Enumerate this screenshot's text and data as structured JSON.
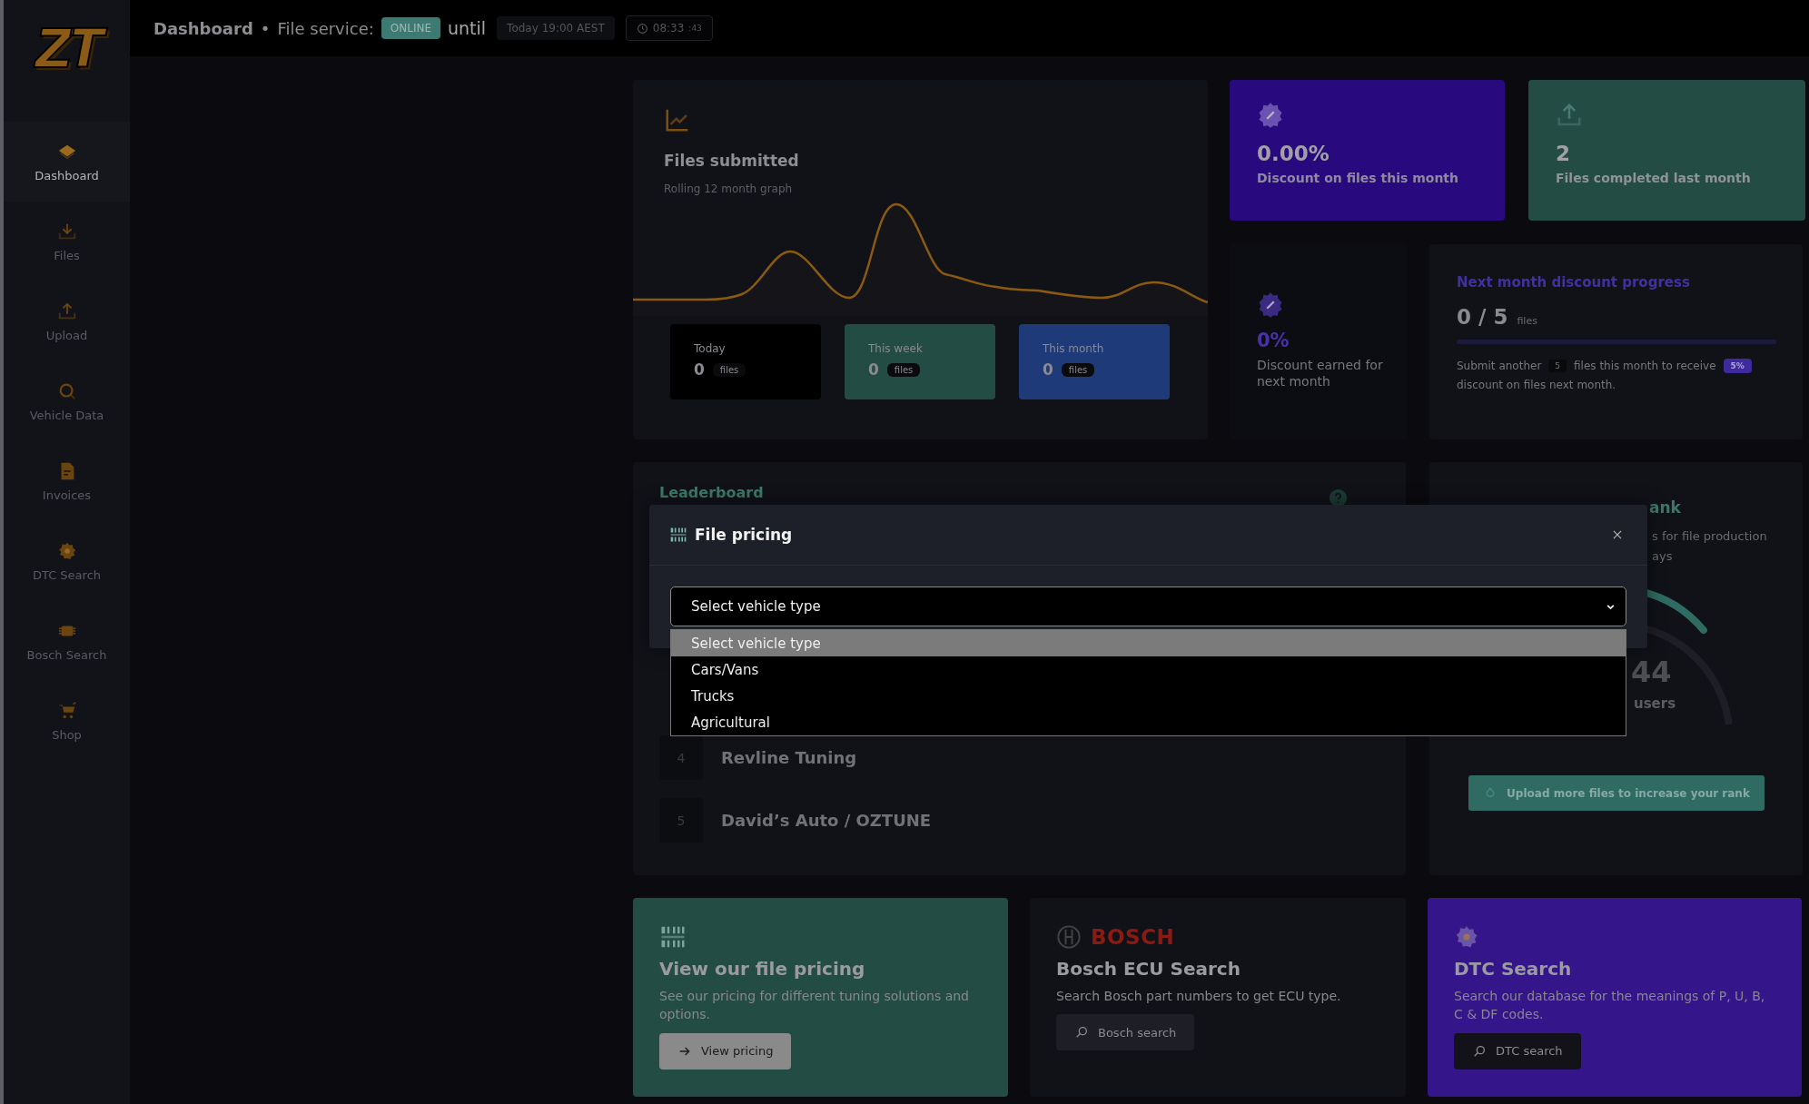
{
  "logo": "ZT",
  "sidebar": {
    "items": [
      {
        "label": "Dashboard",
        "kind": "layers",
        "selected": true
      },
      {
        "label": "Files",
        "kind": "download",
        "selected": false
      },
      {
        "label": "Upload",
        "kind": "upload",
        "selected": false
      },
      {
        "label": "Vehicle Data",
        "kind": "search",
        "selected": false
      },
      {
        "label": "Invoices",
        "kind": "document",
        "selected": false
      },
      {
        "label": "DTC Search",
        "kind": "gear",
        "selected": false
      },
      {
        "label": "Bosch Search",
        "kind": "chip",
        "selected": false
      },
      {
        "label": "Shop",
        "kind": "cart",
        "selected": false
      }
    ]
  },
  "topbar": {
    "title": "Dashboard",
    "separator": "•",
    "service_label": "File service:",
    "status": "ONLINE",
    "until": "until",
    "until_time": "Today 19:00 AEST",
    "clock": "08:33",
    "clock_seconds": ":43"
  },
  "files_card": {
    "title": "Files submitted",
    "subtitle": "Rolling 12 month graph",
    "stats": [
      {
        "label": "Today",
        "value": "0",
        "unit": "files",
        "color": "#000000"
      },
      {
        "label": "This week",
        "value": "0",
        "unit": "files",
        "color": "#234c44"
      },
      {
        "label": "This month",
        "value": "0",
        "unit": "files",
        "color": "#1f3a78"
      }
    ]
  },
  "stat_cards": [
    {
      "kind": "badge",
      "value": "0.00%",
      "label": "Discount on files this month",
      "color": "#290a7e"
    },
    {
      "kind": "upload",
      "value": "2",
      "label": "Files completed last month",
      "color": "#234c44"
    }
  ],
  "discount_earned": {
    "value": "0%",
    "label": "Discount earned for next month"
  },
  "progress": {
    "title": "Next month discount progress",
    "count": "0 / 5",
    "unit": "files",
    "level": 0,
    "note": [
      {
        "kind": "text",
        "text": "Submit another"
      },
      {
        "kind": "count",
        "text": "5"
      },
      {
        "kind": "text",
        "text": "files this month to receive"
      },
      {
        "kind": "percent",
        "text": "5%"
      },
      {
        "kind": "text",
        "text": "discount on files next month."
      }
    ]
  },
  "leaderboard": {
    "title": "Leaderboard",
    "rows": [
      {
        "rank": "4",
        "name": "Revline Tuning"
      },
      {
        "rank": "5",
        "name": "David’s Auto / OZTUNE"
      }
    ]
  },
  "rank_card": {
    "title": "ank",
    "subtitle_lines": [
      "s for file production",
      "ays"
    ],
    "value": "44",
    "unit": "users",
    "button": "Upload more files to increase your rank"
  },
  "actions": [
    {
      "kind": "pricing",
      "title": "View our file pricing",
      "description": "See our pricing for different tuning solutions and options.",
      "button": "View pricing",
      "color": "#234c44"
    },
    {
      "kind": "bosch",
      "brand": "BOSCH",
      "title": "Bosch ECU Search",
      "description": "Search Bosch part numbers to get ECU type.",
      "button": "Bosch search",
      "color": "#111218"
    },
    {
      "kind": "dtc",
      "title": "DTC Search",
      "description": "Search our database for the meanings of P, U, B, C & DF codes.",
      "button": "DTC search",
      "color": "#34158a"
    }
  ],
  "modal": {
    "title": "File pricing",
    "select": {
      "value": "Select vehicle type",
      "expanded": true
    },
    "options": [
      {
        "label": "Select vehicle type",
        "selected": true
      },
      {
        "label": "Cars/Vans",
        "selected": false
      },
      {
        "label": "Trucks",
        "selected": false
      },
      {
        "label": "Agricultural",
        "selected": false
      }
    ]
  }
}
